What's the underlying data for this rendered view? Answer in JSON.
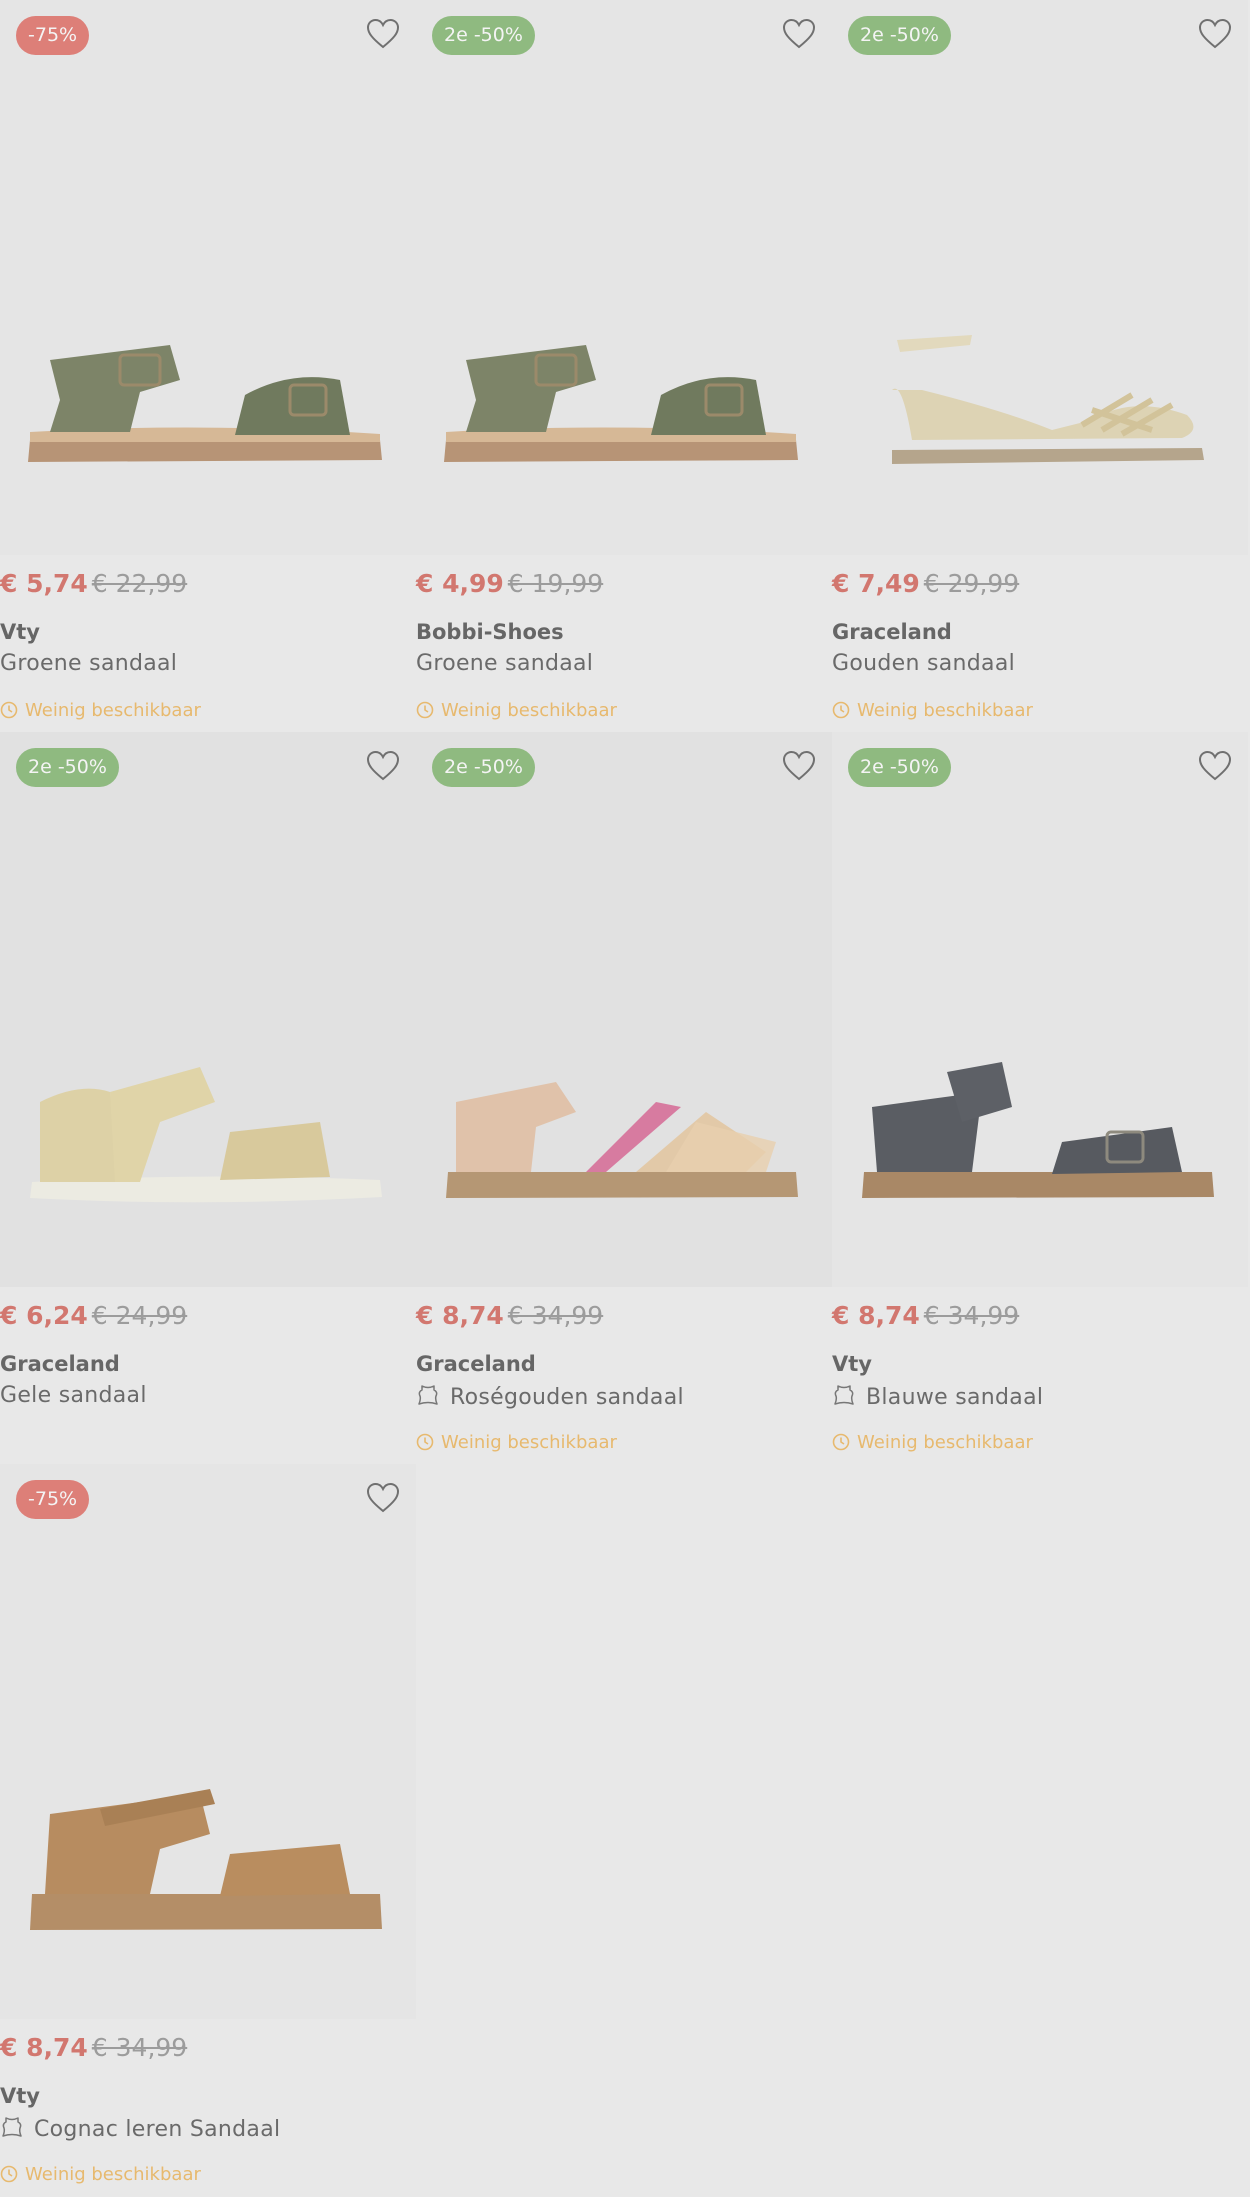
{
  "products": [
    {
      "badge": "-75%",
      "badge_color": "#dd7f78",
      "price": "€ 5,74",
      "old_price": "€ 22,99",
      "brand": "Vty",
      "name": "Groene sandaal",
      "leather": false,
      "stock": "Weinig beschikbaar",
      "shoe": "camo-sandal"
    },
    {
      "badge": "2e -50%",
      "badge_color": "#8fba80",
      "price": "€ 4,99",
      "old_price": "€ 19,99",
      "brand": "Bobbi-Shoes",
      "name": "Groene sandaal",
      "leather": false,
      "stock": "Weinig beschikbaar",
      "shoe": "camo-sandal"
    },
    {
      "badge": "2e -50%",
      "badge_color": "#8fba80",
      "price": "€ 7,49",
      "old_price": "€ 29,99",
      "brand": "Graceland",
      "name": "Gouden sandaal",
      "leather": false,
      "stock": "Weinig beschikbaar",
      "shoe": "gold-sandal"
    },
    {
      "badge": "2e -50%",
      "badge_color": "#8fba80",
      "price": "€ 6,24",
      "old_price": "€ 24,99",
      "brand": "Graceland",
      "name": "Gele sandaal",
      "leather": false,
      "stock": "",
      "shoe": "yellow-sandal"
    },
    {
      "badge": "2e -50%",
      "badge_color": "#8fba80",
      "price": "€ 8,74",
      "old_price": "€ 34,99",
      "brand": "Graceland",
      "name": "Roségouden sandaal",
      "leather": true,
      "stock": "Weinig beschikbaar",
      "shoe": "rose-sandal"
    },
    {
      "badge": "2e -50%",
      "badge_color": "#8fba80",
      "price": "€ 8,74",
      "old_price": "€ 34,99",
      "brand": "Vty",
      "name": "Blauwe sandaal",
      "leather": true,
      "stock": "Weinig beschikbaar",
      "shoe": "blue-sandal"
    },
    {
      "badge": "-75%",
      "badge_color": "#dd7f78",
      "price": "€ 8,74",
      "old_price": "€ 34,99",
      "brand": "Vty",
      "name": "Cognac leren Sandaal",
      "leather": true,
      "stock": "Weinig beschikbaar",
      "shoe": "cognac-sandal"
    }
  ],
  "colors": {
    "price": "#d2776f",
    "old_price": "#9c9c9c",
    "stock": "#e7b96e",
    "background": "#e8e8e8"
  },
  "icons": {
    "favorite": "heart-icon",
    "leather": "leather-hide-icon",
    "stock": "clock-icon"
  }
}
